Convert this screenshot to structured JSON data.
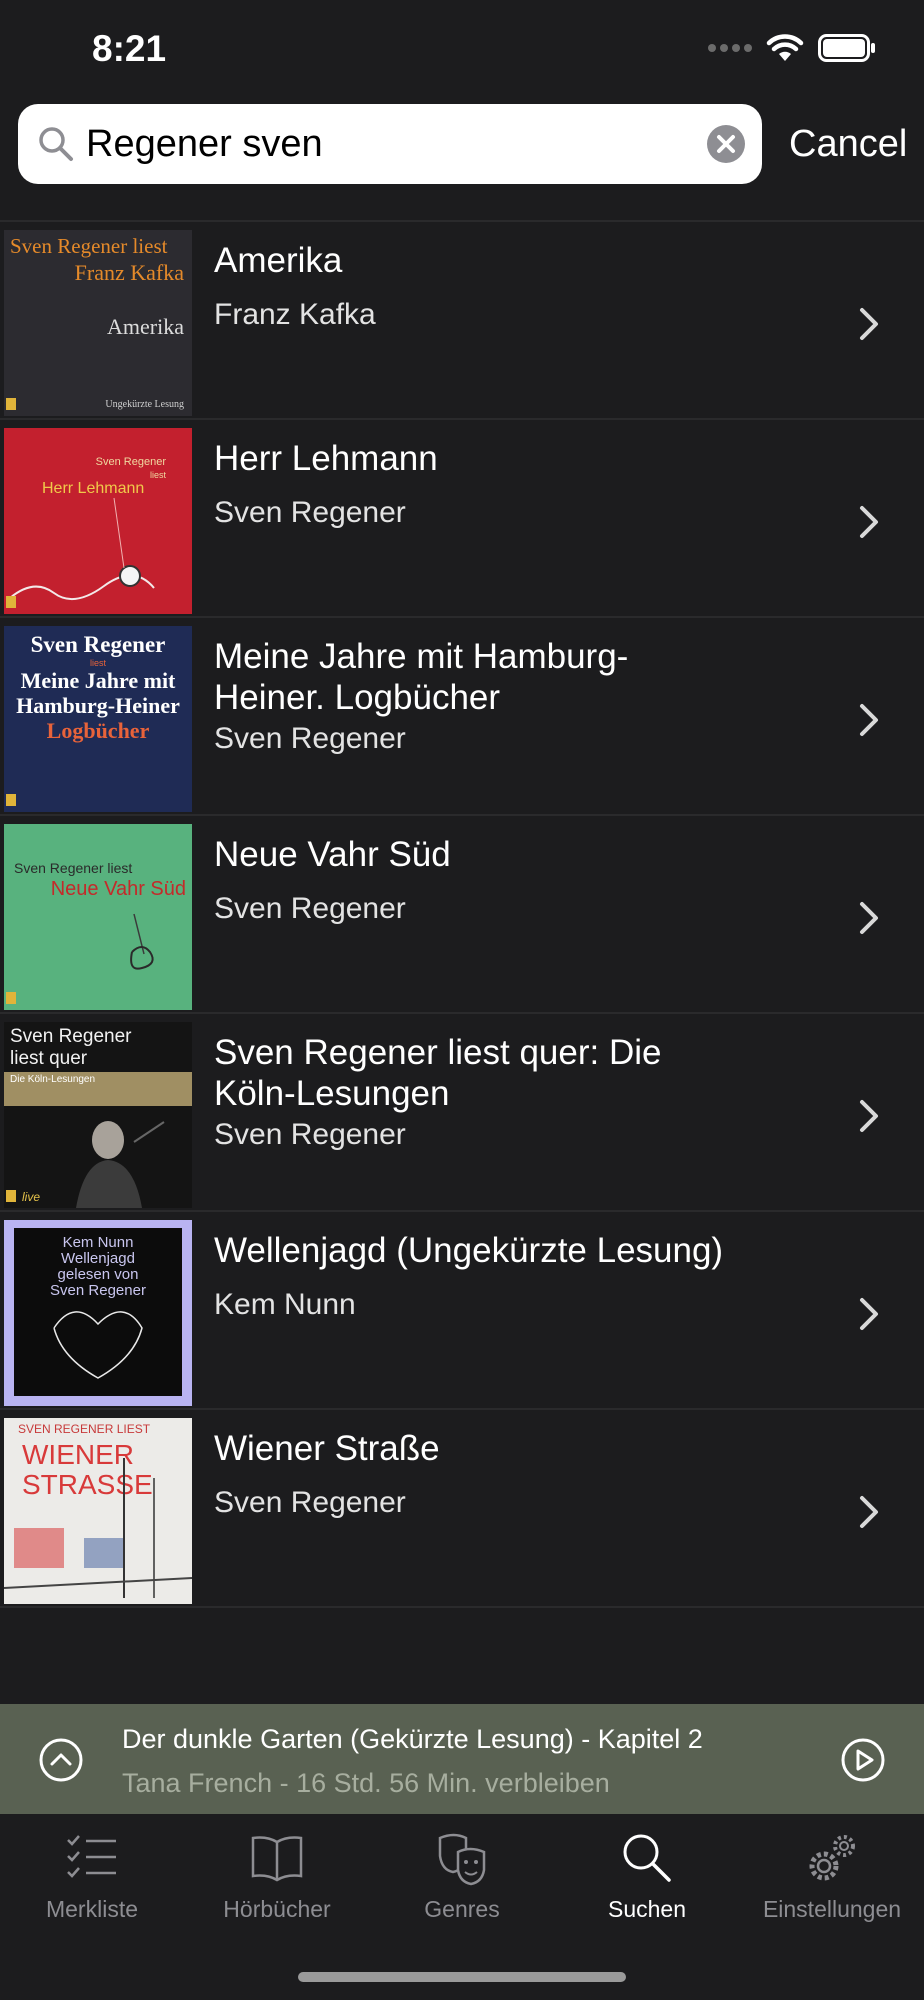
{
  "status_bar": {
    "time": "8:21"
  },
  "search": {
    "query": "Regener sven",
    "cancel_label": "Cancel"
  },
  "results": [
    {
      "title": "Amerika",
      "author": "Franz Kafka",
      "cover": {
        "bg": "#2c2b30",
        "lines": [
          "Sven Regener liest",
          "Franz Kafka"
        ],
        "name": "Amerika",
        "footer": "Ungekürzte Lesung"
      }
    },
    {
      "title": "Herr Lehmann",
      "author": "Sven Regener",
      "cover": {
        "bg": "#c3202e",
        "lines": [
          "Sven Regener",
          "liest"
        ],
        "name": "Herr Lehmann"
      }
    },
    {
      "title": "Meine Jahre mit Hamburg-Heiner. Logbücher",
      "author": "Sven Regener",
      "cover": {
        "bg": "#1f2b55",
        "lines": [
          "Sven Regener",
          "liest",
          "Meine Jahre mit",
          "Hamburg-Heiner"
        ],
        "name": "Logbücher"
      }
    },
    {
      "title": "Neue Vahr Süd",
      "author": "Sven Regener",
      "cover": {
        "bg": "#58b27e",
        "lines": [
          "Sven Regener liest"
        ],
        "name": "Neue Vahr Süd"
      }
    },
    {
      "title": "Sven Regener liest quer: Die Köln-Lesungen",
      "author": "Sven Regener",
      "cover": {
        "bg": "#141414",
        "lines": [
          "Sven Regener",
          "liest quer"
        ],
        "name": "Die Köln-Lesungen",
        "footer": "live"
      }
    },
    {
      "title": "Wellenjagd (Ungekürzte Lesung)",
      "author": "Kem Nunn",
      "cover": {
        "bg": "#b9b4f2",
        "lines": [
          "Kem Nunn",
          "Wellenjagd",
          "gelesen von",
          "Sven Regener"
        ]
      }
    },
    {
      "title": "Wiener Straße",
      "author": "Sven Regener",
      "cover": {
        "bg": "#ecebe8",
        "lines": [
          "SVEN REGENER LIEST"
        ],
        "name": "WIENER STRASSE"
      }
    }
  ],
  "mini_player": {
    "title": "Der dunkle Garten (Gekürzte Lesung) - Kapitel 2",
    "subtitle": "Tana French - 16 Std. 56 Min. verbleiben"
  },
  "tabs": [
    {
      "label": "Merkliste",
      "icon": "checklist-icon",
      "active": false
    },
    {
      "label": "Hörbücher",
      "icon": "book-icon",
      "active": false
    },
    {
      "label": "Genres",
      "icon": "theater-masks-icon",
      "active": false
    },
    {
      "label": "Suchen",
      "icon": "search-icon",
      "active": true
    },
    {
      "label": "Einstellungen",
      "icon": "gears-icon",
      "active": false
    }
  ],
  "colors": {
    "background": "#1c1c1e",
    "mini_player_bg": "#596152",
    "tab_inactive": "#8d8d92",
    "tab_active": "#ffffff"
  }
}
